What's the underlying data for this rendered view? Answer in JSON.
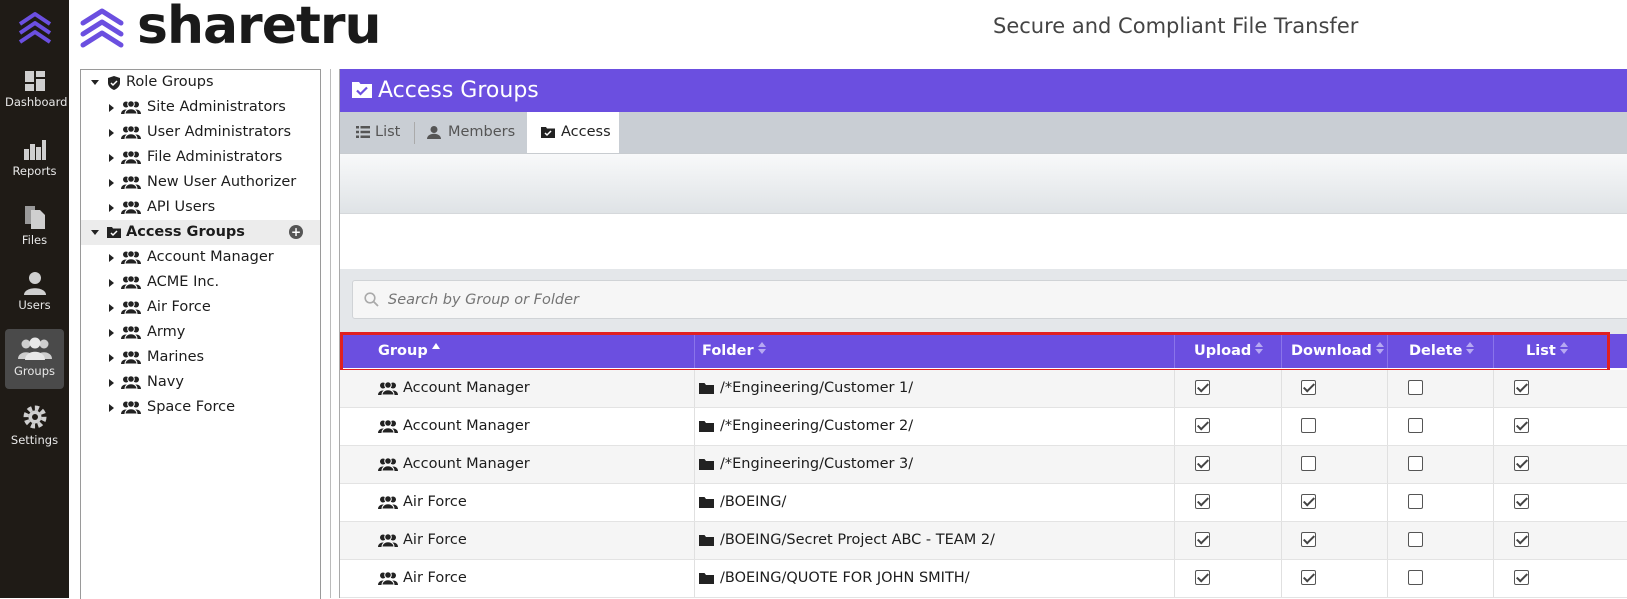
{
  "brand": {
    "name": "sharetru",
    "tagline": "Secure and Compliant File Transfer"
  },
  "nav": [
    {
      "id": "dashboard",
      "label": "Dashboard",
      "active": false
    },
    {
      "id": "reports",
      "label": "Reports",
      "active": false
    },
    {
      "id": "files",
      "label": "Files",
      "active": false
    },
    {
      "id": "users",
      "label": "Users",
      "active": false
    },
    {
      "id": "groups",
      "label": "Groups",
      "active": true
    },
    {
      "id": "settings",
      "label": "Settings",
      "active": false
    }
  ],
  "tree": {
    "role_groups": {
      "label": "Role Groups",
      "children": [
        "Site Administrators",
        "User Administrators",
        "File Administrators",
        "New User Authorizer",
        "API Users"
      ]
    },
    "access_groups": {
      "label": "Access Groups",
      "add_label": "+",
      "children": [
        "Account Manager",
        "ACME Inc.",
        "Air Force",
        "Army",
        "Marines",
        "Navy",
        "Space Force"
      ]
    }
  },
  "panel": {
    "title": "Access Groups",
    "tabs": [
      {
        "id": "list",
        "label": "List",
        "active": false
      },
      {
        "id": "members",
        "label": "Members",
        "active": false
      },
      {
        "id": "access",
        "label": "Access",
        "active": true
      }
    ],
    "search_placeholder": "Search by Group or Folder"
  },
  "table": {
    "headers": {
      "group": "Group",
      "folder": "Folder",
      "upload": "Upload",
      "download": "Download",
      "delete": "Delete",
      "list": "List"
    },
    "rows": [
      {
        "group": "Account Manager",
        "folder": "/*Engineering/Customer 1/",
        "upload": true,
        "download": true,
        "delete": false,
        "list": true
      },
      {
        "group": "Account Manager",
        "folder": "/*Engineering/Customer 2/",
        "upload": true,
        "download": false,
        "delete": false,
        "list": true
      },
      {
        "group": "Account Manager",
        "folder": "/*Engineering/Customer 3/",
        "upload": true,
        "download": false,
        "delete": false,
        "list": true
      },
      {
        "group": "Air Force",
        "folder": "/BOEING/",
        "upload": true,
        "download": true,
        "delete": false,
        "list": true
      },
      {
        "group": "Air Force",
        "folder": "/BOEING/Secret Project ABC - TEAM 2/",
        "upload": true,
        "download": true,
        "delete": false,
        "list": true
      },
      {
        "group": "Air Force",
        "folder": "/BOEING/QUOTE FOR JOHN SMITH/",
        "upload": true,
        "download": true,
        "delete": false,
        "list": true
      }
    ]
  },
  "colors": {
    "accent": "#6b4fe0",
    "nav_bg": "#1f1b16",
    "highlight": "#e02020"
  }
}
